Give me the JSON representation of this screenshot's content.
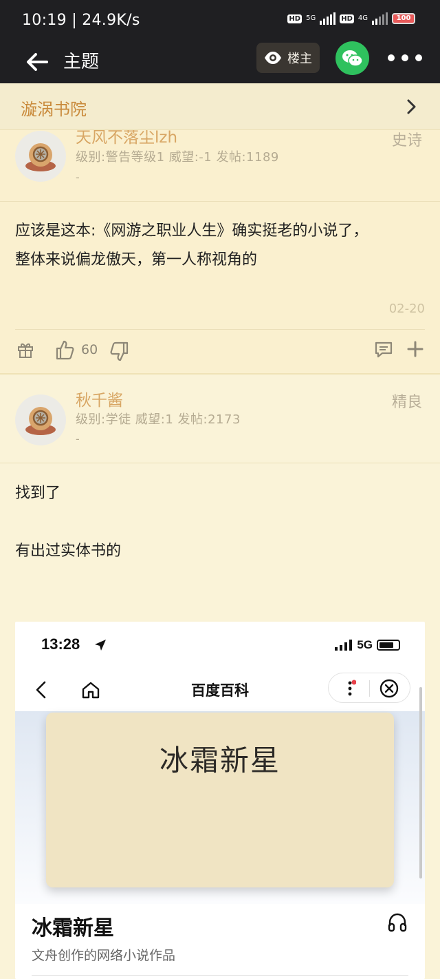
{
  "status_bar": {
    "time": "10:19 | 24.9K/s",
    "hd1": "HD",
    "net1": "5G",
    "hd2": "HD",
    "net2": "4G",
    "battery": "100"
  },
  "header": {
    "title": "主题",
    "owner_label": "楼主"
  },
  "forum": {
    "name": "漩涡书院"
  },
  "posts": [
    {
      "username": "天风不落尘lzh",
      "rank": "史诗",
      "meta": "级别:警告等级1 威望:-1 发帖:1189",
      "signature": "-",
      "line1": "应该是这本:《网游之职业人生》确实挺老的小说了，",
      "line2": "整体来说偏龙傲天，第一人称视角的",
      "date": "02-20",
      "likes": "60"
    },
    {
      "username": "秋千酱",
      "rank": "精良",
      "meta": "级别:学徒 威望:1 发帖:2173",
      "signature": "-",
      "line1": "找到了",
      "line2": "有出过实体书的"
    }
  ],
  "embed": {
    "time": "13:28",
    "network": "5G",
    "nav_title": "百度百科",
    "cover_title": "冰霜新星",
    "entry_name": "冰霜新星",
    "entry_desc": "文舟创作的网络小说作品"
  },
  "colors": {
    "page_bg": "#faf3d8",
    "header_bg": "#1f1f22",
    "accent_orange": "#c98a3b",
    "wechat_green": "#2fc15e"
  }
}
